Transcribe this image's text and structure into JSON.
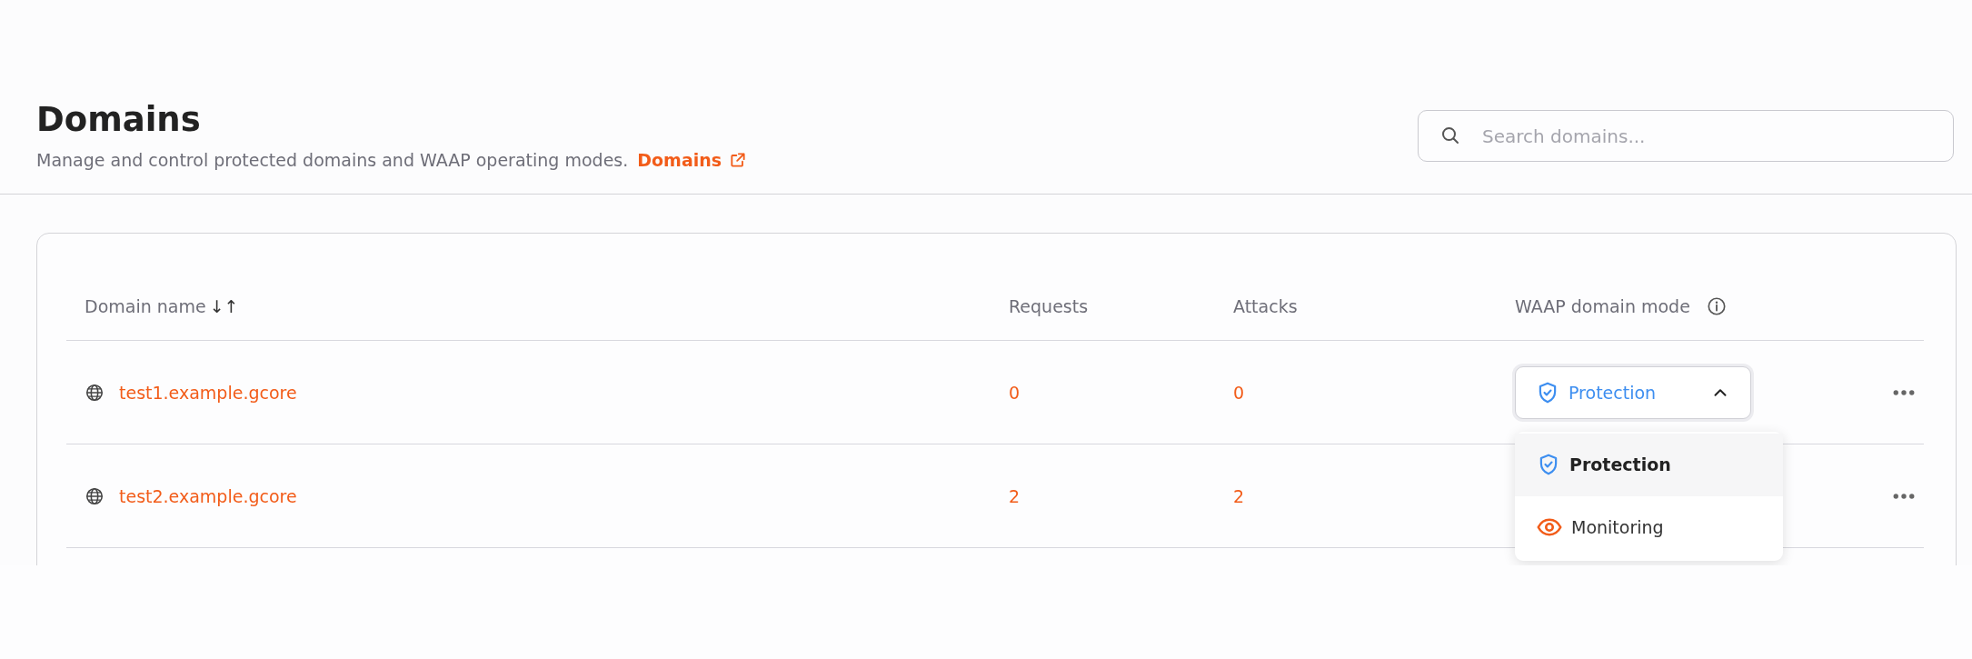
{
  "header": {
    "title": "Domains",
    "description": "Manage and control protected domains and WAAP operating modes.",
    "link": "Domains"
  },
  "search": {
    "placeholder": "Search domains..."
  },
  "table": {
    "columns": [
      {
        "label": "Domain name",
        "sort_indicator": "↓↑",
        "kind": "sortable"
      },
      {
        "label": "Requests",
        "kind": "plain"
      },
      {
        "label": "Attacks",
        "kind": "plain"
      },
      {
        "label": "WAAP domain mode",
        "kind": "info"
      }
    ],
    "rows": [
      {
        "domain": "test1.example.gcore",
        "requests": "0",
        "attacks": "0",
        "mode": {
          "value": "Protection",
          "kind": "protection",
          "expanded": true
        }
      },
      {
        "domain": "test2.example.gcore",
        "requests": "2",
        "attacks": "2"
      }
    ]
  },
  "mode_menu": {
    "options": [
      {
        "label": "Protection",
        "kind": "protection",
        "selected": true
      },
      {
        "label": "Monitoring",
        "kind": "monitoring",
        "selected": false
      }
    ]
  }
}
